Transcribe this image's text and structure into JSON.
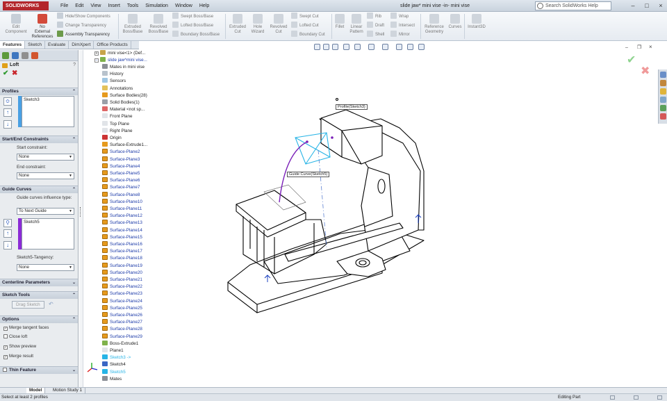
{
  "app": {
    "logo": "SOLIDWORKS",
    "document_title": "slide jaw* mini vise -in- mini vise"
  },
  "menu": [
    "File",
    "Edit",
    "View",
    "Insert",
    "Tools",
    "Simulation",
    "Window",
    "Help"
  ],
  "search": {
    "placeholder": "Search SolidWorks Help"
  },
  "ribbon": {
    "edit_component": "Edit\nComponent",
    "no_external": "No\nExternal\nReferences",
    "hide_show": "Hide/Show Components",
    "change_transparency": "Change Transparency",
    "assembly_transparency": "Assembly Transparency",
    "extruded_boss": "Extruded\nBoss/Base",
    "revolved_boss": "Revolved\nBoss/Base",
    "swept_boss": "Swept Boss/Base",
    "lofted_boss": "Lofted Boss/Base",
    "boundary_boss": "Boundary Boss/Base",
    "extruded_cut": "Extruded\nCut",
    "hole_wizard": "Hole\nWizard",
    "revolved_cut": "Revolved\nCut",
    "swept_cut": "Swept Cut",
    "lofted_cut": "Lofted Cut",
    "boundary_cut": "Boundary Cut",
    "fillet": "Fillet",
    "linear_pattern": "Linear\nPattern",
    "rib": "Rib",
    "draft": "Draft",
    "shell": "Shell",
    "wrap": "Wrap",
    "intersect": "Intersect",
    "mirror": "Mirror",
    "reference_geometry": "Reference\nGeometry",
    "curves": "Curves",
    "instant3d": "Instant3D"
  },
  "tabs": [
    "Features",
    "Sketch",
    "Evaluate",
    "DimXpert",
    "Office Products"
  ],
  "property_manager": {
    "title": "Loft",
    "profiles_header": "Profiles",
    "profiles": [
      "Sketch3"
    ],
    "start_end_header": "Start/End Constraints",
    "start_constraint_label": "Start constraint:",
    "start_constraint_value": "None",
    "end_constraint_label": "End constraint:",
    "end_constraint_value": "None",
    "guide_header": "Guide Curves",
    "guide_influence_label": "Guide curves influence type:",
    "guide_influence_value": "To Next Guide",
    "guide_curves": [
      "Sketch5"
    ],
    "tangency_label": "Sketch5-Tangency:",
    "tangency_value": "None",
    "centerline_header": "Centerline Parameters",
    "sketch_tools_header": "Sketch Tools",
    "drag_sketch": "Drag Sketch",
    "options_header": "Options",
    "options": [
      {
        "label": "Merge tangent faces",
        "checked": true
      },
      {
        "label": "Close loft",
        "checked": false
      },
      {
        "label": "Show preview",
        "checked": true
      },
      {
        "label": "Merge result",
        "checked": true
      }
    ],
    "thin_feature": "Thin Feature"
  },
  "tree": {
    "top": [
      "mini vise<1> (Def...",
      "slide jaw^mini vise..."
    ],
    "items": [
      "Mates in mini vise",
      "History",
      "Sensors",
      "Annotations",
      "Surface Bodies(28)",
      "Solid Bodies(1)",
      "Material <not sp...",
      "Front Plane",
      "Top Plane",
      "Right Plane",
      "Origin",
      "Surface-Extrude1..."
    ],
    "surface_planes": [
      "Surface-Plane2",
      "Surface-Plane3",
      "Surface-Plane4",
      "Surface-Plane5",
      "Surface-Plane6",
      "Surface-Plane7",
      "Surface-Plane8",
      "Surface-Plane10",
      "Surface-Plane11",
      "Surface-Plane12",
      "Surface-Plane13",
      "Surface-Plane14",
      "Surface-Plane15",
      "Surface-Plane16",
      "Surface-Plane17",
      "Surface-Plane18",
      "Surface-Plane19",
      "Surface-Plane20",
      "Surface-Plane21",
      "Surface-Plane22",
      "Surface-Plane23",
      "Surface-Plane24",
      "Surface-Plane25",
      "Surface-Plane26",
      "Surface-Plane27",
      "Surface-Plane28",
      "Surface-Plane29"
    ],
    "bottom": [
      "Boss-Extrude1",
      "Plane1",
      "Sketch3 ->",
      "Sketch4",
      "Sketch5",
      "Mates"
    ]
  },
  "callouts": {
    "profile": "Profile(Sketch3)",
    "guide": "Guide Curve(Sketch5)"
  },
  "bottom_tabs": [
    "Model",
    "Motion Study 1"
  ],
  "status": {
    "message": "Select at least 2 profiles",
    "mode": "Editing Part"
  },
  "colors": {
    "accent_blue": "#1b3aa8",
    "cyan_sketch": "#27b4e6",
    "purple_guide": "#7a1fb8",
    "surface_orange": "#e69a1d"
  }
}
